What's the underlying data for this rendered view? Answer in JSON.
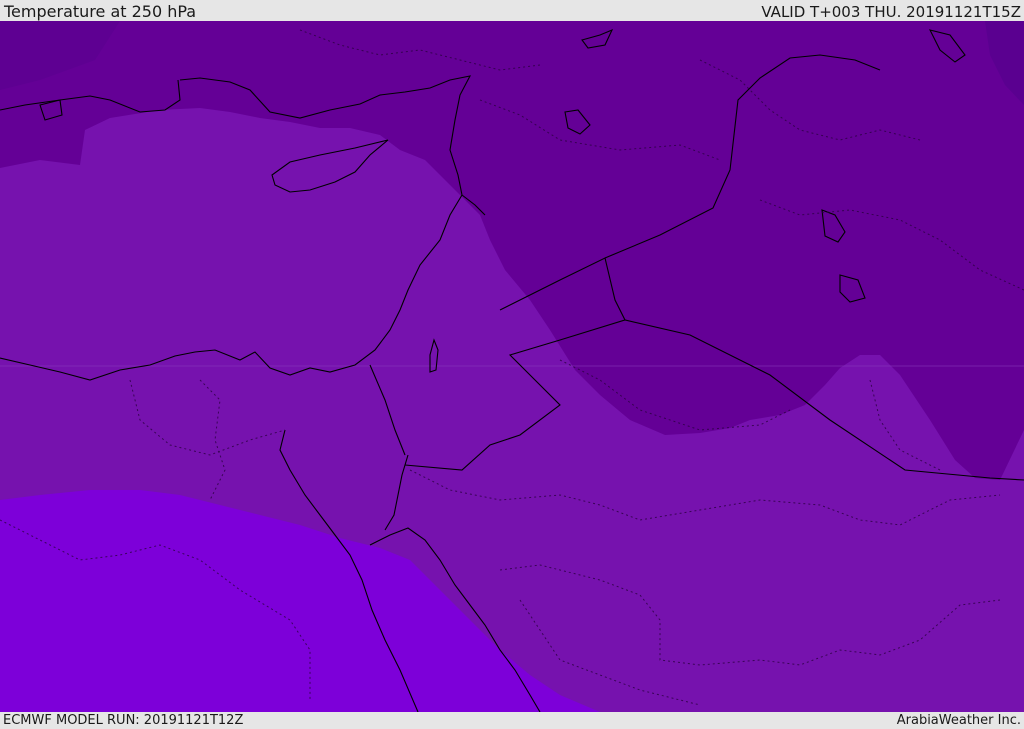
{
  "header": {
    "title": "Temperature at 250 hPa",
    "valid": "VALID T+003 THU. 20191121T15Z"
  },
  "footer": {
    "model_run": "ECMWF MODEL RUN: 20191121T12Z",
    "credit": "ArabiaWeather Inc."
  },
  "map": {
    "field": "temperature",
    "level": "250 hPa",
    "colors": {
      "coldest": "#5a0090",
      "cold": "#640096",
      "mid": "#7612ae",
      "warm": "#7d00d9",
      "coastline": "#000000"
    }
  }
}
